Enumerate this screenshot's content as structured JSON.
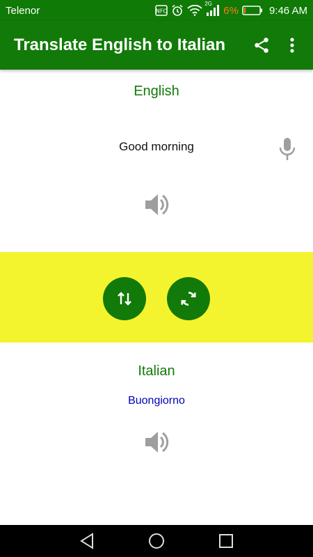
{
  "status_bar": {
    "carrier": "Telenor",
    "network_label": "2G",
    "battery_percent": "6%",
    "time": "9:46 AM",
    "icons": [
      "nfc-icon",
      "alarm-icon",
      "wifi-icon",
      "signal-icon",
      "battery-icon"
    ]
  },
  "app_bar": {
    "title": "Translate English to Italian",
    "actions": [
      "share-icon",
      "more-vert-icon"
    ]
  },
  "source": {
    "language": "English",
    "input_value": "Good morning",
    "mic_icon": "mic-icon",
    "speaker_icon": "speaker-icon"
  },
  "controls": {
    "swap_icon": "swap-vert-icon",
    "refresh_icon": "refresh-icon"
  },
  "target": {
    "language": "Italian",
    "translation": "Buongiorno",
    "speaker_icon": "speaker-icon"
  },
  "nav_bar": {
    "buttons": [
      "back-icon",
      "home-icon",
      "recents-icon"
    ]
  },
  "colors": {
    "primary_green": "#127a08",
    "status_green": "#0f7a05",
    "band_yellow": "#f4f42e",
    "translation_blue": "#0000b8",
    "battery_low_orange": "#ff7a1a",
    "icon_gray": "#9e9e9e"
  }
}
